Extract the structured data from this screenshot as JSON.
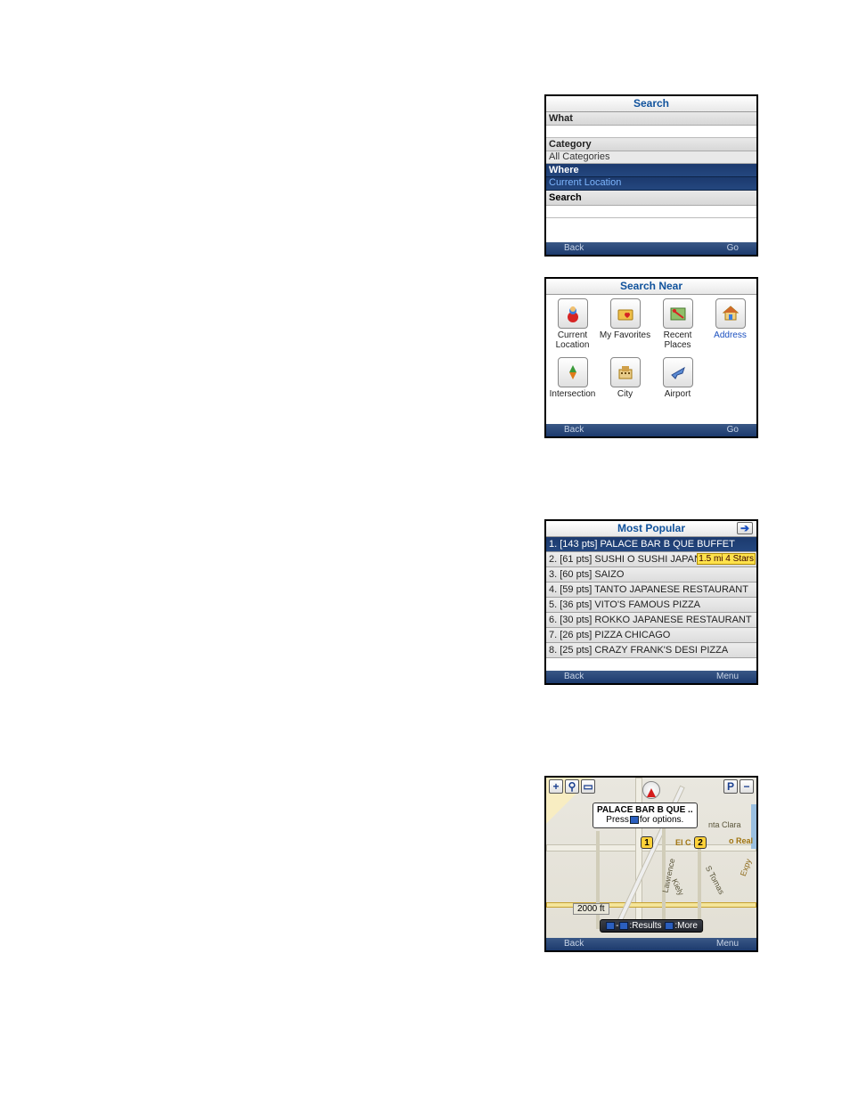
{
  "s1": {
    "title": "Search",
    "what_label": "What",
    "what_value": "",
    "category_label": "Category",
    "category_value": "All Categories",
    "where_label": "Where",
    "where_value": "Current Location",
    "search_label": "Search",
    "soft_left": "Back",
    "soft_right": "Go"
  },
  "s2": {
    "title": "Search Near",
    "items": [
      {
        "label": "Current Location"
      },
      {
        "label": "My Favorites"
      },
      {
        "label": "Recent Places"
      },
      {
        "label": "Address"
      },
      {
        "label": "Intersection"
      },
      {
        "label": "City"
      },
      {
        "label": "Airport"
      }
    ],
    "soft_left": "Back",
    "soft_right": "Go"
  },
  "s3": {
    "title": "Most Popular",
    "results": [
      {
        "text": "1. [143 pts] PALACE BAR B QUE BUFFET"
      },
      {
        "text": "2. [61 pts] SUSHI O SUSHI JAPAN",
        "extra": "1.5 mi 4 Stars"
      },
      {
        "text": "3. [60 pts] SAIZO"
      },
      {
        "text": "4. [59 pts] TANTO JAPANESE RESTAURANT"
      },
      {
        "text": "5. [36 pts] VITO'S FAMOUS PIZZA"
      },
      {
        "text": "6. [30 pts] ROKKO JAPANESE RESTAURANT"
      },
      {
        "text": "7. [26 pts] PIZZA CHICAGO"
      },
      {
        "text": "8. [25 pts] CRAZY FRANK'S DESI PIZZA"
      }
    ],
    "soft_left": "Back",
    "soft_right": "Menu"
  },
  "s4": {
    "callout_title": "PALACE BAR B QUE ..",
    "callout_hint_pre": "Press",
    "callout_hint_post": "for options.",
    "pin1": "1",
    "pin2": "2",
    "road_elc": "El C",
    "road_real": "o Real",
    "road_clara": "nta Clara",
    "road_lawrence": "Lawrence",
    "road_kiely": "Kiely",
    "road_tomas": "S  Tomas",
    "road_expy": "Expy",
    "scale": "2000 ft",
    "hint_results": ":Results",
    "hint_more": ":More",
    "zoom_in": "+",
    "zoom_out": "−",
    "p_badge": "P",
    "soft_left": "Back",
    "soft_right": "Menu"
  }
}
